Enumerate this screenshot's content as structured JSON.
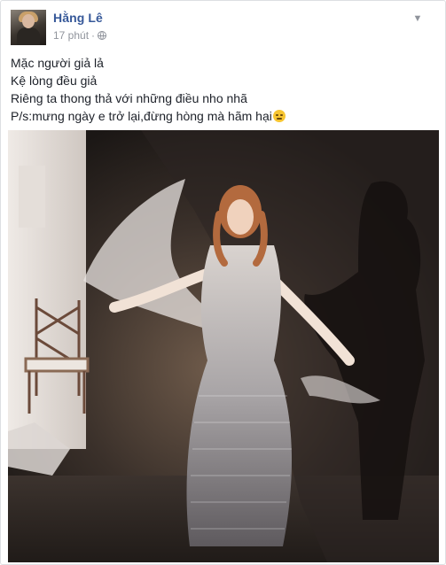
{
  "post": {
    "author": "Hằng Lê",
    "timestamp": "17 phút",
    "separator": "·",
    "privacy_icon": "globe-icon",
    "menu_icon": "chevron-down-icon",
    "lines": [
      "Mặc người giả lả",
      "Kệ lòng đều giả",
      "Riêng ta thong thả với những điều nho nhã",
      "P/s:mưng ngày e trở lại,đừng hòng mà hãm hại"
    ],
    "emoji_icon": "angry-face-emoji-icon",
    "media_type": "photo"
  },
  "colors": {
    "author_link": "#365899",
    "meta_text": "#90949c",
    "body_text": "#1d2129",
    "border": "#dddfe2"
  }
}
